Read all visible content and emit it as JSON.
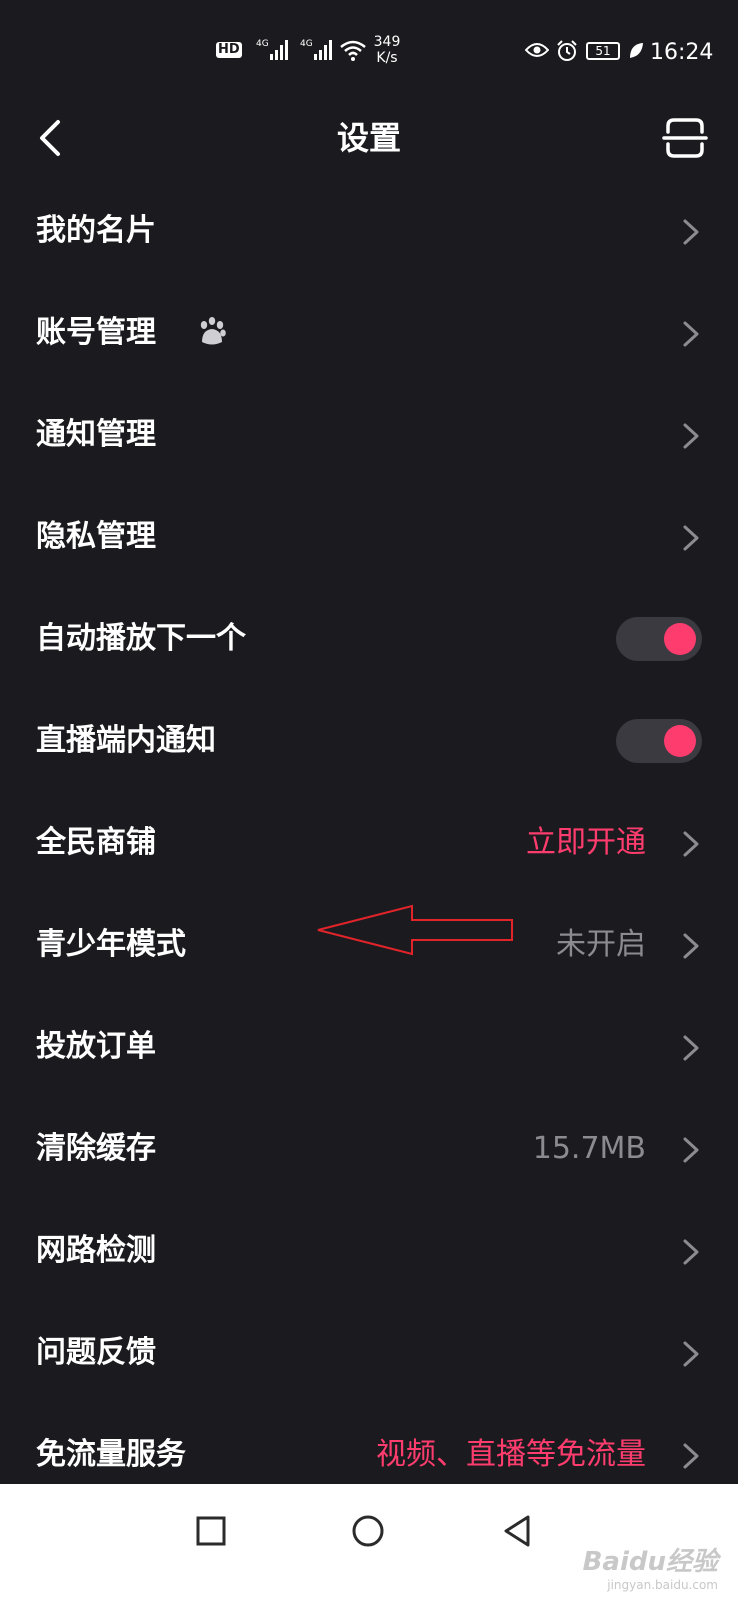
{
  "status_bar": {
    "hd": "HD",
    "signal_1": "4G",
    "signal_2": "4G",
    "speed_value": "349",
    "speed_unit": "K/s",
    "battery": "51",
    "time": "16:24"
  },
  "header": {
    "title": "设置",
    "back_icon": "chevron-left-icon",
    "scan_icon": "scan-icon"
  },
  "settings": {
    "items": [
      {
        "label": "我的名片"
      },
      {
        "label": "账号管理",
        "badge": "baidu-paw-icon"
      },
      {
        "label": "通知管理"
      },
      {
        "label": "隐私管理"
      },
      {
        "label": "自动播放下一个",
        "toggle": true
      },
      {
        "label": "直播端内通知",
        "toggle": true
      },
      {
        "label": "全民商铺",
        "value": "立即开通"
      },
      {
        "label": "青少年模式",
        "value": "未开启"
      },
      {
        "label": "投放订单"
      },
      {
        "label": "清除缓存",
        "value": "15.7MB"
      },
      {
        "label": "网路检测"
      },
      {
        "label": "问题反馈"
      },
      {
        "label": "免流量服务",
        "value": "视频、直播等免流量"
      }
    ]
  },
  "colors": {
    "background": "#1b1b1f",
    "accent": "#fe3c6e",
    "muted": "#8c8c90",
    "annotation": "#e0242a"
  },
  "nav_bar": {
    "recent_icon": "square-icon",
    "home_icon": "circle-icon",
    "back_icon": "triangle-back-icon"
  },
  "watermark": {
    "brand": "Baidu经验",
    "site": "jingyan.baidu.com"
  }
}
